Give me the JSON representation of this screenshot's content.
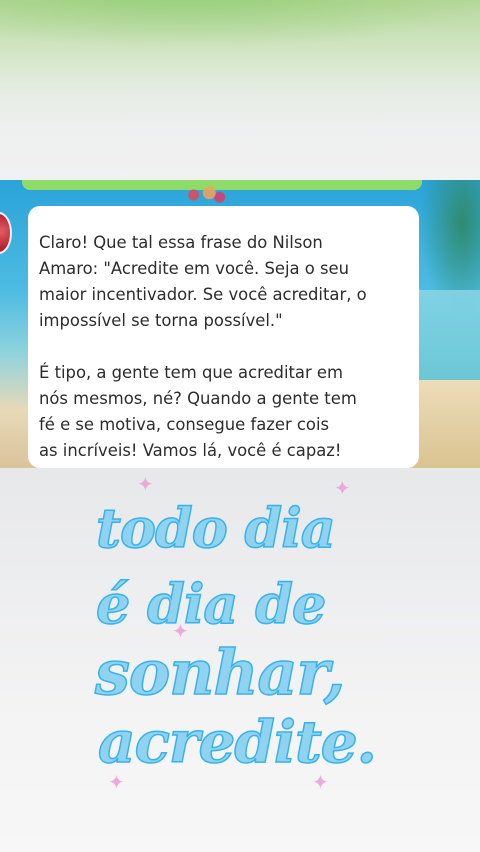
{
  "chat": {
    "message_paragraphs": [
      "Claro! Que tal essa frase do Nilson\nAmaro: \"Acredite em você. Seja o seu\n maior incentivador. Se você acreditar, o\nimpossível se torna possível.\"",
      "É tipo, a gente tem que acreditar em\nnós mesmos, né? Quando a gente tem\nfé e se motiva, consegue fazer cois\nas incríveis! Vamos lá, você é capaz!"
    ]
  },
  "quote": {
    "lines": [
      "todo dia",
      "é dia de",
      "sonhar,",
      "acredite."
    ],
    "color": "#38b3ea"
  },
  "colors": {
    "bubble": "#ffffff",
    "green_bar": "#8edb6a",
    "sparkle": "#ecaad8"
  },
  "icons": {
    "sparkle": "✦"
  }
}
